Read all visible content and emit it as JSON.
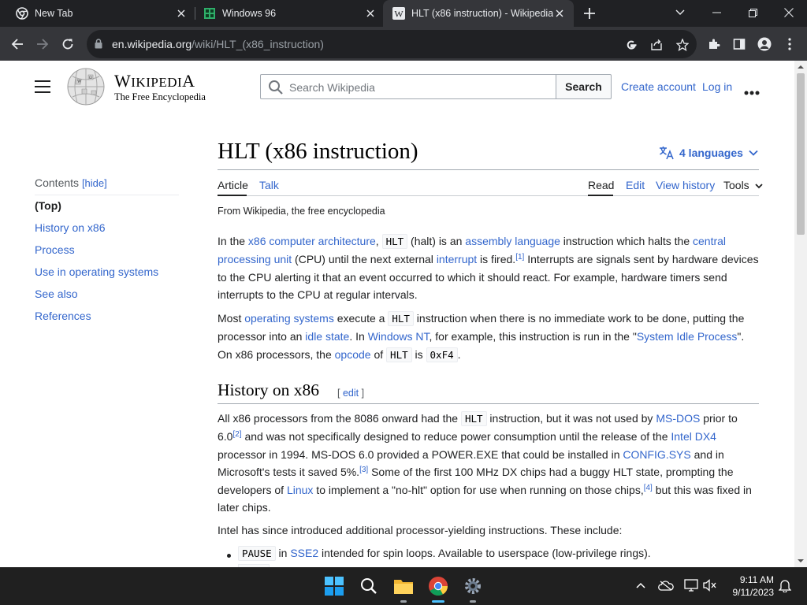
{
  "browser": {
    "tabs": [
      {
        "title": "New Tab",
        "favicon": "chrome-icon",
        "active": false
      },
      {
        "title": "Windows 96",
        "favicon": "windows96-icon",
        "active": false
      },
      {
        "title": "HLT (x86 instruction) - Wikipedia",
        "favicon": "wikipedia-icon",
        "active": true
      }
    ],
    "url_host": "en.wikipedia.org",
    "url_path": "/wiki/HLT_(x86_instruction)"
  },
  "wiki": {
    "logo_title_cap1": "W",
    "logo_title_rest1": "IKIPEDI",
    "logo_title_cap2": "A",
    "tagline": "The Free Encyclopedia",
    "search_placeholder": "Search Wikipedia",
    "search_button": "Search",
    "create_account": "Create account",
    "log_in": "Log in"
  },
  "toc": {
    "title": "Contents",
    "hide": "[hide]",
    "items": [
      "(Top)",
      "History on x86",
      "Process",
      "Use in operating systems",
      "See also",
      "References"
    ]
  },
  "article": {
    "title": "HLT (x86 instruction)",
    "languages": "4 languages",
    "tabs_left": [
      "Article",
      "Talk"
    ],
    "tabs_right": [
      "Read",
      "Edit",
      "View history",
      "Tools"
    ],
    "from": "From Wikipedia, the free encyclopedia",
    "p1": {
      "t1": "In the ",
      "l1": "x86 computer architecture",
      "t2": ", ",
      "c1": "HLT",
      "t3": " (halt) is an ",
      "l2": "assembly language",
      "t4": " instruction which halts the ",
      "l3": "central processing unit",
      "t5": " (CPU) until the next external ",
      "l4": "interrupt",
      "t6": " is fired.",
      "ref1": "[1]",
      "t7": " Interrupts are signals sent by hardware devices to the CPU alerting it that an event occurred to which it should react. For example, hardware timers send interrupts to the CPU at regular intervals."
    },
    "p2": {
      "t1": "Most ",
      "l1": "operating systems",
      "t2": " execute a ",
      "c1": "HLT",
      "t3": " instruction when there is no immediate work to be done, putting the processor into an ",
      "l2": "idle state",
      "t4": ". In ",
      "l3": "Windows NT",
      "t5": ", for example, this instruction is run in the \"",
      "l4": "System Idle Process",
      "t6": "\". On x86 processors, the ",
      "l5": "opcode",
      "t7": " of ",
      "c2": "HLT",
      "t8": " is ",
      "c3": "0xF4",
      "t9": "."
    },
    "h2": "History on x86",
    "h2_edit_open": "[ ",
    "h2_edit": "edit",
    "h2_edit_close": " ]",
    "p3": {
      "t1": "All x86 processors from the 8086 onward had the ",
      "c1": "HLT",
      "t2": " instruction, but it was not used by ",
      "l1": "MS-DOS",
      "t3": " prior to 6.0",
      "ref2": "[2]",
      "t4": " and was not specifically designed to reduce power consumption until the release of the ",
      "l2": "Intel DX4",
      "t5": " processor in 1994. MS-DOS 6.0 provided a POWER.EXE that could be installed in ",
      "l3": "CONFIG.SYS",
      "t6": " and in Microsoft's tests it saved 5%.",
      "ref3": "[3]",
      "t7": " Some of the first 100 MHz DX chips had a buggy HLT state, prompting the developers of ",
      "l4": "Linux",
      "t8": " to implement a \"no-hlt\" option for use when running on those chips,",
      "ref4": "[4]",
      "t9": " but this was fixed in later chips."
    },
    "p4": "Intel has since introduced additional processor-yielding instructions. These include:",
    "li1": {
      "c1": "PAUSE",
      "t1": " in ",
      "l1": "SSE2",
      "t2": " intended for spin loops. Available to userspace (low-privilege rings)."
    }
  },
  "taskbar": {
    "time": "9:11 AM",
    "date": "9/11/2023",
    "icons": [
      "windows-start-icon",
      "search-icon",
      "file-explorer-icon",
      "chrome-icon",
      "settings-icon"
    ]
  },
  "colors": {
    "link": "#3366cc",
    "text": "#202122",
    "chrome_dark": "#202124",
    "chrome_toolbar": "#35363a",
    "taskbar": "#202020"
  }
}
